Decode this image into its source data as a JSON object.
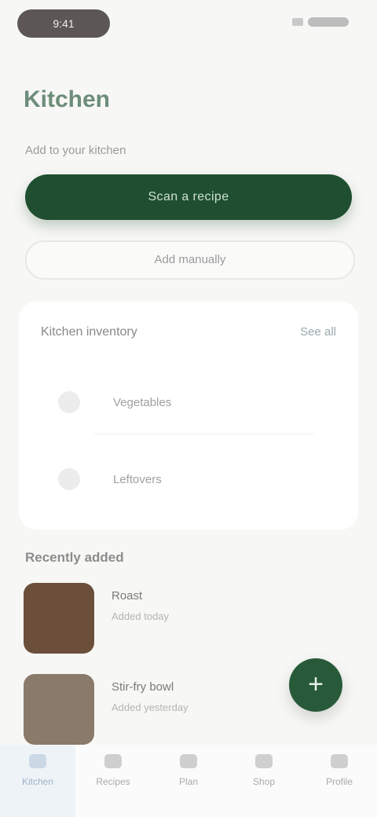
{
  "status": {
    "time": "9:41"
  },
  "page": {
    "title": "Kitchen"
  },
  "scan": {
    "label": "Add to your kitchen",
    "primary_label": "Scan a recipe",
    "secondary_label": "Add manually"
  },
  "pantry": {
    "title": "Kitchen inventory",
    "action": "See all",
    "rows": [
      {
        "label": "Vegetables"
      },
      {
        "label": "Leftovers"
      }
    ]
  },
  "recent": {
    "label": "Recently added",
    "items": [
      {
        "title": "Roast",
        "subtitle": "Added today",
        "color": "#6b4f3b"
      },
      {
        "title": "Stir-fry bowl",
        "subtitle": "Added yesterday",
        "color": "#8a7a6a"
      }
    ]
  },
  "fab": {
    "icon": "plus-icon",
    "symbol": "+"
  },
  "tabs": [
    {
      "label": "Kitchen",
      "icon": "home-icon"
    },
    {
      "label": "Recipes",
      "icon": "book-icon"
    },
    {
      "label": "Plan",
      "icon": "calendar-icon"
    },
    {
      "label": "Shop",
      "icon": "cart-icon"
    },
    {
      "label": "Profile",
      "icon": "person-icon"
    }
  ]
}
